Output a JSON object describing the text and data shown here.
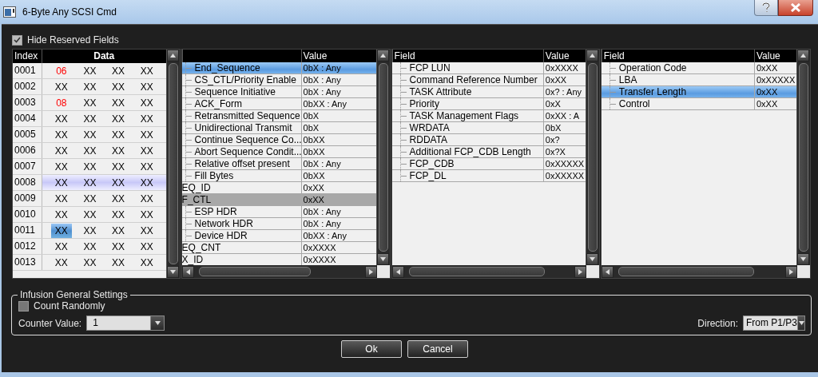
{
  "window": {
    "title": "6-Byte Any SCSI Cmd"
  },
  "hide_reserved": {
    "label": "Hide Reserved Fields",
    "checked": true
  },
  "data_grid": {
    "columns": [
      "Index",
      "Data"
    ],
    "rows": [
      {
        "index": "0001",
        "hovered": false,
        "cells": [
          {
            "text": "06",
            "color": "#ff0000",
            "selected": false
          },
          {
            "text": "XX",
            "selected": false
          },
          {
            "text": "XX",
            "selected": false
          },
          {
            "text": "XX",
            "selected": false
          }
        ]
      },
      {
        "index": "0002",
        "hovered": false,
        "cells": [
          {
            "text": "XX",
            "selected": false
          },
          {
            "text": "XX",
            "selected": false
          },
          {
            "text": "XX",
            "selected": false
          },
          {
            "text": "XX",
            "selected": false
          }
        ]
      },
      {
        "index": "0003",
        "hovered": false,
        "cells": [
          {
            "text": "08",
            "color": "#ff0000",
            "selected": false
          },
          {
            "text": "XX",
            "selected": false
          },
          {
            "text": "XX",
            "selected": false
          },
          {
            "text": "XX",
            "selected": false
          }
        ]
      },
      {
        "index": "0004",
        "hovered": false,
        "cells": [
          {
            "text": "XX",
            "selected": false
          },
          {
            "text": "XX",
            "selected": false
          },
          {
            "text": "XX",
            "selected": false
          },
          {
            "text": "XX",
            "selected": false
          }
        ]
      },
      {
        "index": "0005",
        "hovered": false,
        "cells": [
          {
            "text": "XX",
            "selected": false
          },
          {
            "text": "XX",
            "selected": false
          },
          {
            "text": "XX",
            "selected": false
          },
          {
            "text": "XX",
            "selected": false
          }
        ]
      },
      {
        "index": "0006",
        "hovered": false,
        "cells": [
          {
            "text": "XX",
            "selected": false
          },
          {
            "text": "XX",
            "selected": false
          },
          {
            "text": "XX",
            "selected": false
          },
          {
            "text": "XX",
            "selected": false
          }
        ]
      },
      {
        "index": "0007",
        "hovered": false,
        "cells": [
          {
            "text": "XX",
            "selected": false
          },
          {
            "text": "XX",
            "selected": false
          },
          {
            "text": "XX",
            "selected": false
          },
          {
            "text": "XX",
            "selected": false
          }
        ]
      },
      {
        "index": "0008",
        "hovered": true,
        "cells": [
          {
            "text": "XX",
            "selected": false
          },
          {
            "text": "XX",
            "selected": false
          },
          {
            "text": "XX",
            "selected": false
          },
          {
            "text": "XX",
            "selected": false
          }
        ]
      },
      {
        "index": "0009",
        "hovered": false,
        "cells": [
          {
            "text": "XX",
            "selected": false
          },
          {
            "text": "XX",
            "selected": false
          },
          {
            "text": "XX",
            "selected": false
          },
          {
            "text": "XX",
            "selected": false
          }
        ]
      },
      {
        "index": "0010",
        "hovered": false,
        "cells": [
          {
            "text": "XX",
            "selected": false
          },
          {
            "text": "XX",
            "selected": false
          },
          {
            "text": "XX",
            "selected": false
          },
          {
            "text": "XX",
            "selected": false
          }
        ]
      },
      {
        "index": "0011",
        "hovered": false,
        "cells": [
          {
            "text": "XX",
            "selected": true
          },
          {
            "text": "XX",
            "selected": false
          },
          {
            "text": "XX",
            "selected": false
          },
          {
            "text": "XX",
            "selected": false
          }
        ]
      },
      {
        "index": "0012",
        "hovered": false,
        "cells": [
          {
            "text": "XX",
            "selected": false
          },
          {
            "text": "XX",
            "selected": false
          },
          {
            "text": "XX",
            "selected": false
          },
          {
            "text": "XX",
            "selected": false
          }
        ]
      },
      {
        "index": "0013",
        "hovered": false,
        "cells": [
          {
            "text": "XX",
            "selected": false
          },
          {
            "text": "XX",
            "selected": false
          },
          {
            "text": "XX",
            "selected": false
          },
          {
            "text": "XX",
            "selected": false
          }
        ]
      }
    ]
  },
  "trees": [
    {
      "columns": [
        "",
        "Value"
      ],
      "rows": [
        {
          "children": [
            {
              "field": "End_Sequence",
              "value": "0bX : Any",
              "selected": true
            },
            {
              "field": "CS_CTL/Priority Enable",
              "value": "0bX : Any",
              "selected": false
            },
            {
              "field": "Sequence Initiative",
              "value": "0bX : Any",
              "selected": false
            },
            {
              "field": "ACK_Form",
              "value": "0bXX : Any",
              "selected": false
            },
            {
              "field": "Retransmitted Sequence",
              "value": "0bX",
              "selected": false
            },
            {
              "field": "Unidirectional Transmit",
              "value": "0bX",
              "selected": false
            },
            {
              "field": "Continue Sequence Co...",
              "value": "0bXX",
              "selected": false
            },
            {
              "field": "Abort Sequence Condit...",
              "value": "0bXX",
              "selected": false
            },
            {
              "field": "Relative offset present",
              "value": "0bX : Any",
              "selected": false
            },
            {
              "field": "Fill Bytes",
              "value": "0bXX",
              "selected": false
            }
          ]
        },
        {
          "field": "EQ_ID",
          "value": "0xXX",
          "selected": false
        },
        {
          "field": "F_CTL",
          "value": "0xXX",
          "selected": false,
          "hovered": true,
          "children": [
            {
              "field": "ESP HDR",
              "value": "0bX : Any",
              "selected": false
            },
            {
              "field": "Network HDR",
              "value": "0bX : Any",
              "selected": false
            },
            {
              "field": "Device HDR",
              "value": "0bXX : Any",
              "selected": false
            }
          ]
        },
        {
          "field": "EQ_CNT",
          "value": "0xXXXX",
          "selected": false
        },
        {
          "field": "X_ID",
          "value": "0xXXXX",
          "selected": false
        }
      ]
    },
    {
      "columns": [
        "Field",
        "Value"
      ],
      "rows": [
        {
          "children": [
            {
              "field": "FCP LUN",
              "value": "0xXXXX",
              "selected": false
            },
            {
              "field": "Command Reference Number",
              "value": "0xXX",
              "selected": false
            },
            {
              "field": "TASK Attribute",
              "value": "0x? : Any",
              "selected": false
            },
            {
              "field": "Priority",
              "value": "0xX",
              "selected": false
            },
            {
              "field": "TASK Management Flags",
              "value": "0xXX : A",
              "selected": false
            },
            {
              "field": "WRDATA",
              "value": "0bX",
              "selected": false
            },
            {
              "field": "RDDATA",
              "value": "0x?",
              "selected": false
            },
            {
              "field": "Additional FCP_CDB Length",
              "value": "0x?X",
              "selected": false
            },
            {
              "field": "FCP_CDB",
              "value": "0xXXXXX",
              "selected": false
            },
            {
              "field": "FCP_DL",
              "value": "0xXXXXX",
              "selected": false
            }
          ]
        }
      ]
    },
    {
      "columns": [
        "Field",
        "Value"
      ],
      "rows": [
        {
          "children": [
            {
              "field": "Operation Code",
              "value": "0xXX",
              "selected": false
            },
            {
              "field": "LBA",
              "value": "0xXXXXX",
              "selected": false
            },
            {
              "field": "Transfer Length",
              "value": "0xXX",
              "selected": true
            },
            {
              "field": "Control",
              "value": "0xXX",
              "selected": false
            }
          ]
        }
      ]
    }
  ],
  "settings": {
    "title": "Infusion General Settings",
    "count_randomly": {
      "label": "Count Randomly",
      "checked": false
    },
    "counter_value": {
      "label": "Counter Value:",
      "value": "1"
    },
    "direction": {
      "label": "Direction:",
      "value": "From P1/P3"
    }
  },
  "buttons": [
    "Ok",
    "Cancel"
  ]
}
